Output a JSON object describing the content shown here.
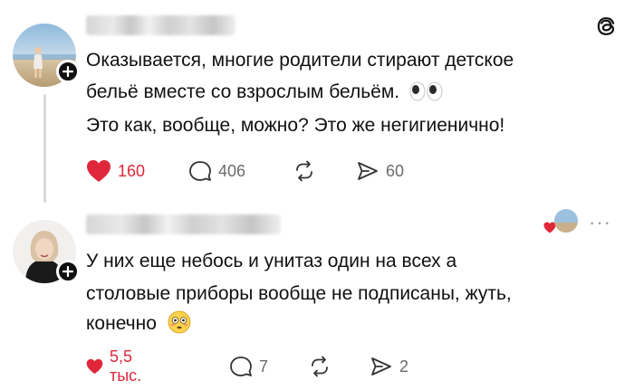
{
  "posts": [
    {
      "lines": [
        "Оказывается, многие родители стирают детское",
        "бельё вместе со взрослым бельём.",
        "Это как, вообще, можно? Это же негигиенично!"
      ],
      "likes": "160",
      "replies": "406",
      "shares": "60",
      "inline_emoji": "eyes-emoji"
    },
    {
      "lines": [
        "У них еще небось и унитаз один на всех а",
        "столовые приборы вообще не подписаны, жуть,",
        "конечно"
      ],
      "likes": "5,5 тыс.",
      "replies": "7",
      "shares": "2",
      "inline_emoji": "flushed-face-emoji"
    }
  ],
  "icons": {
    "like": "heart-icon",
    "reply": "comment-bubble-icon",
    "repost": "repost-icon",
    "share": "send-icon",
    "app": "threads-logo-icon"
  },
  "colors": {
    "like_red": "#e0263a",
    "muted_gray": "#6b6b6b",
    "text": "#111111"
  }
}
